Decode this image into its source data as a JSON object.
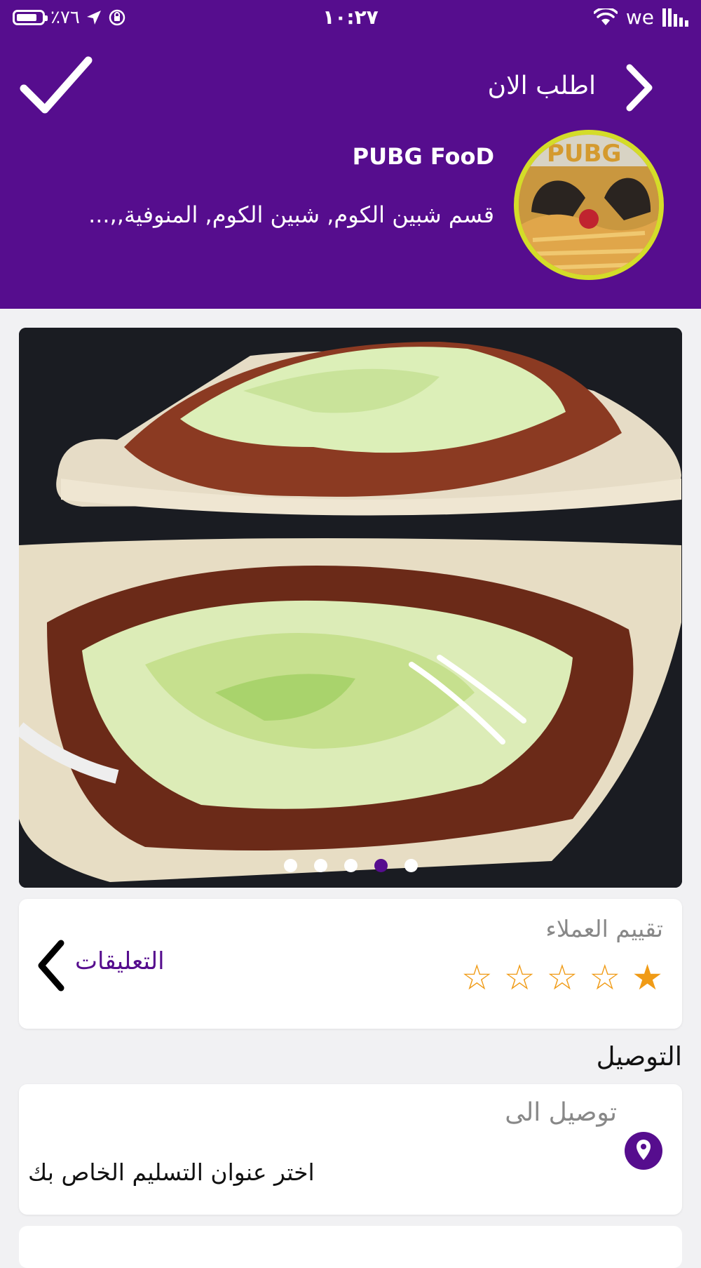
{
  "status_bar": {
    "battery": "٪٧٦",
    "time": "١٠:٢٧",
    "carrier": "we"
  },
  "header": {
    "order_now": "اطلب الان",
    "store_name": "PUBG FooD",
    "store_address": "قسم شبين الكوم, شبين الكوم, المنوفية,,..."
  },
  "gallery": {
    "dot_count": 5,
    "active_index": 3
  },
  "rating": {
    "title": "تقييم العملاء",
    "value": 1,
    "max": 5,
    "comments_label": "التعليقات",
    "star_color": "#f09b16"
  },
  "delivery": {
    "heading": "التوصيل",
    "deliver_to": "توصيل الى",
    "placeholder": "اختر عنوان التسليم الخاص بك"
  },
  "colors": {
    "brand": "#560d8e",
    "logo_ring": "#d4dc29"
  }
}
